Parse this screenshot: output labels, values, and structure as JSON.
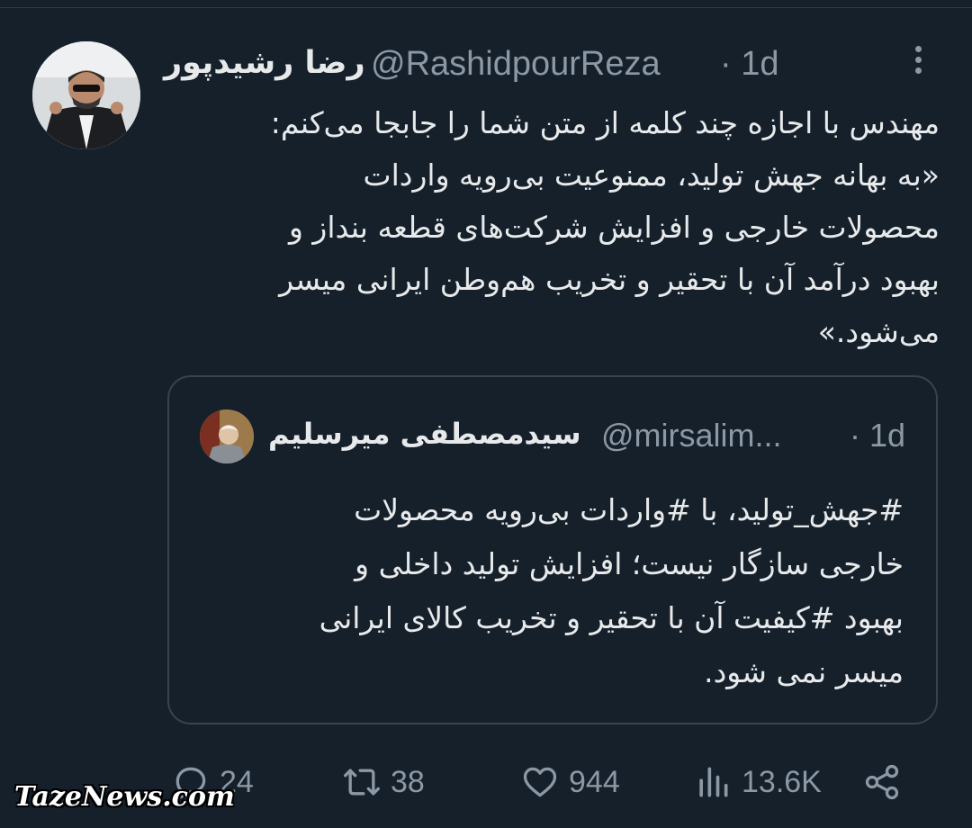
{
  "tweet": {
    "author": {
      "display_name": "رضا رشیدپور",
      "handle": "@RashidpourReza",
      "time": "· 1d"
    },
    "text": "مهندس با اجازه چند کلمه از متن شما را جابجا می‌کنم:\n«به بهانه جهش تولید، ممنوعیت بی‌رویه واردات\nمحصولات خارجی و افزایش شرکت‌های قطعه بنداز و\nبهبود درآمد آن با تحقیر و تخریب هم‌وطن ایرانی میسر\nمی‌شود.»",
    "more_icon": "more-vertical-icon"
  },
  "quote": {
    "author": {
      "display_name": "سیدمصطفی میرسلیم",
      "handle": "@mirsalim...",
      "time": "· 1d"
    },
    "text": "#جهش_تولید، با #واردات بی‌رویه محصولات\nخارجی سازگار نیست؛ افزایش تولید داخلی و\nبهبود #کیفیت آن با تحقیر و تخریب کالای ایرانی\nمیسر نمی شود."
  },
  "actions": {
    "reply": {
      "icon": "reply-icon",
      "count": "24"
    },
    "retweet": {
      "icon": "retweet-icon",
      "count": "38"
    },
    "like": {
      "icon": "heart-icon",
      "count": "944"
    },
    "views": {
      "icon": "views-icon",
      "count": "13.6K"
    },
    "share": {
      "icon": "share-icon"
    }
  },
  "watermark": "TazeNews.com",
  "colors": {
    "background": "#15202b",
    "text": "#e7e9ea",
    "secondary": "#8b98a5",
    "border": "#38444d"
  }
}
